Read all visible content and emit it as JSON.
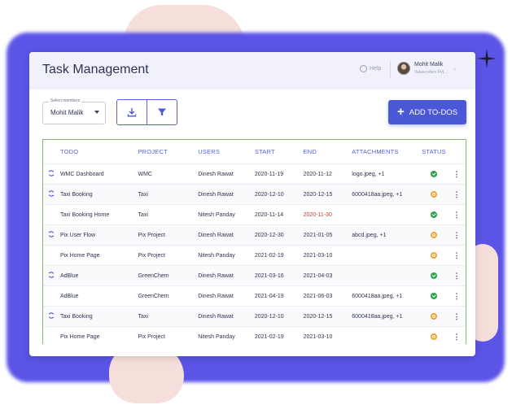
{
  "colors": {
    "accent": "#4a57d6",
    "header_bg": "#f1f1fb",
    "backdrop": "#5b54e6",
    "blob": "#f6dedb",
    "table_border": "#7fbd6a",
    "overdue": "#e03434",
    "status_done": "#2ba24c",
    "status_pending": "#f0a22e"
  },
  "header": {
    "title": "Task Management",
    "help_label": "Help",
    "help_icon": "help-bubble-icon",
    "user_name": "Mohit Malik",
    "user_org": "Valuecoders Pvt...",
    "user_menu_icon": "chevron-down-icon"
  },
  "toolbar": {
    "members_legend": "Select members",
    "members_value": "Mohit Malik",
    "download_icon": "download-icon",
    "filter_icon": "filter-icon",
    "add_label": "ADD TO-DOS"
  },
  "table": {
    "columns": [
      "TODO",
      "PROJECT",
      "USERS",
      "START",
      "END",
      "ATTACHMENTS",
      "STATUS"
    ],
    "rows": [
      {
        "recurring": true,
        "todo": "WMC Dashboard",
        "project": "WMC",
        "user": "Dinesh Rawat",
        "start": "2020-11-19",
        "end": "2020-11-12",
        "end_overdue": false,
        "attachments": "logo.jpeg, +1",
        "status": "done"
      },
      {
        "recurring": true,
        "todo": "Taxi Booking",
        "project": "Taxi",
        "user": "Dinesh Rawat",
        "start": "2020-12-10",
        "end": "2020-12-15",
        "end_overdue": false,
        "attachments": "6000418aa.jpeg, +1",
        "status": "pending"
      },
      {
        "recurring": false,
        "todo": "Taxi Booking Home",
        "project": "Taxi",
        "user": "Nitesh Panday",
        "start": "2020-11-14",
        "end": "2020-11-30",
        "end_overdue": true,
        "attachments": "",
        "status": "done"
      },
      {
        "recurring": true,
        "todo": "Pix User Flow",
        "project": "Pix Project",
        "user": "Dinesh Rawat",
        "start": "2020-12-30",
        "end": "2021-01-05",
        "end_overdue": false,
        "attachments": "abcd.jpeg, +1",
        "status": "pending"
      },
      {
        "recurring": false,
        "todo": "Pix Home Page",
        "project": "Pix Project",
        "user": "Nitesh Panday",
        "start": "2021-02-19",
        "end": "2021-03-10",
        "end_overdue": false,
        "attachments": "",
        "status": "pending"
      },
      {
        "recurring": true,
        "todo": "AdBlue",
        "project": "GreenChem",
        "user": "Dinesh Rawat",
        "start": "2021-03-16",
        "end": "2021-04-03",
        "end_overdue": false,
        "attachments": "",
        "status": "done"
      },
      {
        "recurring": false,
        "todo": "AdBlue",
        "project": "GreenChem",
        "user": "Dinesh Rawat",
        "start": "2021-04-19",
        "end": "2021-06-03",
        "end_overdue": false,
        "attachments": "6000418aa.jpeg, +1",
        "status": "done"
      },
      {
        "recurring": true,
        "todo": "Taxi Booking",
        "project": "Taxi",
        "user": "Dinesh Rawat",
        "start": "2020-12-10",
        "end": "2020-12-15",
        "end_overdue": false,
        "attachments": "6000418aa.jpeg, +1",
        "status": "pending"
      },
      {
        "recurring": false,
        "todo": "Pix Home Page",
        "project": "Pix Project",
        "user": "Nitesh Panday",
        "start": "2021-02-19",
        "end": "2021-03-10",
        "end_overdue": false,
        "attachments": "",
        "status": "pending"
      }
    ]
  }
}
